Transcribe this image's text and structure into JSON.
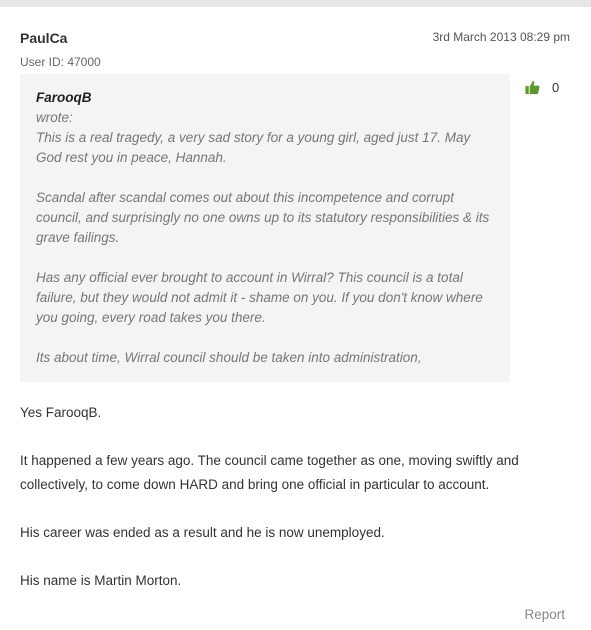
{
  "post": {
    "username": "PaulCa",
    "timestamp": "3rd March 2013 08:29 pm",
    "user_id": "User ID: 47000",
    "likes": "0",
    "quote": {
      "author": "FarooqB",
      "wrote": "wrote:",
      "paragraphs": [
        "This is a real tragedy, a very sad story for a young girl, aged just 17. May God rest you in peace, Hannah.",
        "Scandal after scandal comes out about this incompetence and corrupt council, and surprisingly no one owns up to its statutory responsibilities & its grave failings.",
        "Has any official ever brought to account in Wirral? This council is a total failure, but they would not admit it - shame on you. If you don't know where you going, every road takes you there.",
        "Its about time, Wirral council should be taken into administration,"
      ]
    },
    "body": [
      "Yes FarooqB.",
      "It happened a few years ago. The council came together as one, moving swiftly and collectively, to come down HARD and bring one official in particular to account.",
      "His career was ended as a result and he is now unemployed.",
      "His name is Martin Morton."
    ],
    "report_label": "Report"
  },
  "icons": {
    "like": "thumbs-up-icon"
  },
  "colors": {
    "like_icon": "#5a9a2a",
    "quote_bg": "#f4f4f4"
  }
}
